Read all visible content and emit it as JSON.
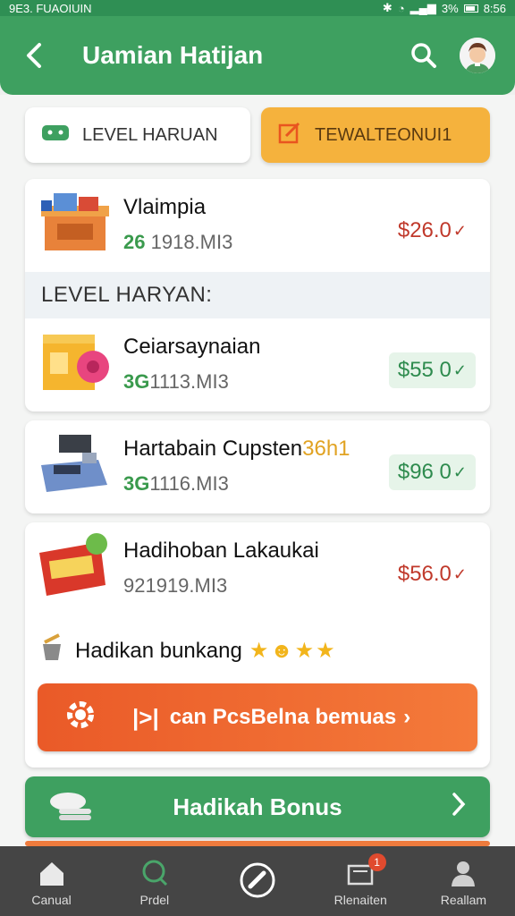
{
  "status_bar": {
    "left_text": "9E3. FUAOIUIN",
    "battery_text": "3%",
    "time": "8:56"
  },
  "app_bar": {
    "title": "Uamian Hatijan",
    "back_icon": "chevron-left-icon",
    "search_icon": "search-icon",
    "avatar_icon": "avatar"
  },
  "tabs": [
    {
      "label": "LEVEL HARUAN",
      "icon": "gamepad-icon"
    },
    {
      "label": "TEWALTEONUI1",
      "icon": "edit-icon"
    }
  ],
  "featured_item": {
    "name": "Vlaimpia",
    "code": "26",
    "meta": "1918.MI3",
    "price": "$26.0",
    "icon": "market-stall-icon"
  },
  "section_header": "LEVEL HARYAN:",
  "items": [
    {
      "name": "Ceiarsaynaian",
      "code": "3G",
      "meta": "1113.MI3",
      "price": "$55 0",
      "icon": "tape-box-icon"
    },
    {
      "name": "Hartabain Cupsten",
      "name_suffix": "36h1",
      "code": "3G",
      "meta": "1116.MI3",
      "price": "$96 0",
      "icon": "cash-register-icon"
    },
    {
      "name": "Hadihoban Lakaukai",
      "code": "",
      "meta": "921919.MI3",
      "price": "$56.0",
      "icon": "sale-sign-icon"
    }
  ],
  "bonus_line": {
    "text": "Hadikan bunkang",
    "stars": "★☻★★",
    "icon": "gift-bucket-icon"
  },
  "claim_button": {
    "label": "can PcsBelna bemuas",
    "icon": "gear-icon",
    "separator": "|>|",
    "arrow": "›"
  },
  "bonus_button": {
    "label": "Hadikah Bonus",
    "icon": "coins-icon",
    "chevron": "›"
  },
  "bottom_nav": [
    {
      "label": "Canual",
      "icon": "home-icon"
    },
    {
      "label": "Prdel",
      "icon": "search-icon"
    },
    {
      "label": "",
      "icon": "pen-icon"
    },
    {
      "label": "Rlenaiten",
      "icon": "cart-icon",
      "badge": "1"
    },
    {
      "label": "Reallam",
      "icon": "user-icon"
    }
  ],
  "colors": {
    "primary_green": "#3ea060",
    "accent_orange": "#ee7b3d",
    "tab_orange": "#f5b23d",
    "price_red": "#c0392b",
    "nav_bg": "#454545"
  }
}
